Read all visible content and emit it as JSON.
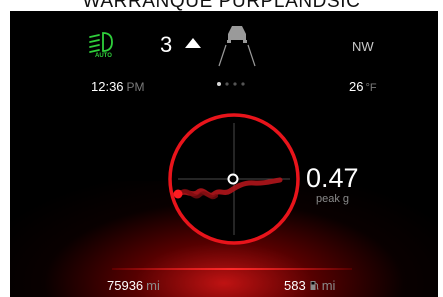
{
  "top_caption": "WARRANQUE PURPLANDSIC",
  "header": {
    "headlight_mode": "AUTO",
    "gear": "3",
    "compass": "NW"
  },
  "info": {
    "time": "12:36",
    "time_period": "PM",
    "temperature": "26",
    "temperature_unit": "°F"
  },
  "pager": {
    "total": 4,
    "active_index": 0
  },
  "gforce": {
    "value": "0.47",
    "label": "peak g"
  },
  "footer": {
    "odometer": "75936",
    "odometer_unit": "mi",
    "range": "583",
    "range_unit": "mi"
  },
  "icons": {
    "headlight": "headlight-icon",
    "gear_up": "upshift-arrow-icon",
    "vehicle": "vehicle-lane-icon",
    "fuel": "fuel-pump-icon"
  },
  "colors": {
    "screen_bg": "#000000",
    "accent_red": "#e8141b",
    "indicator_green": "#2fcf3b",
    "text_primary": "#ffffff",
    "text_secondary": "#8a8a8a"
  }
}
